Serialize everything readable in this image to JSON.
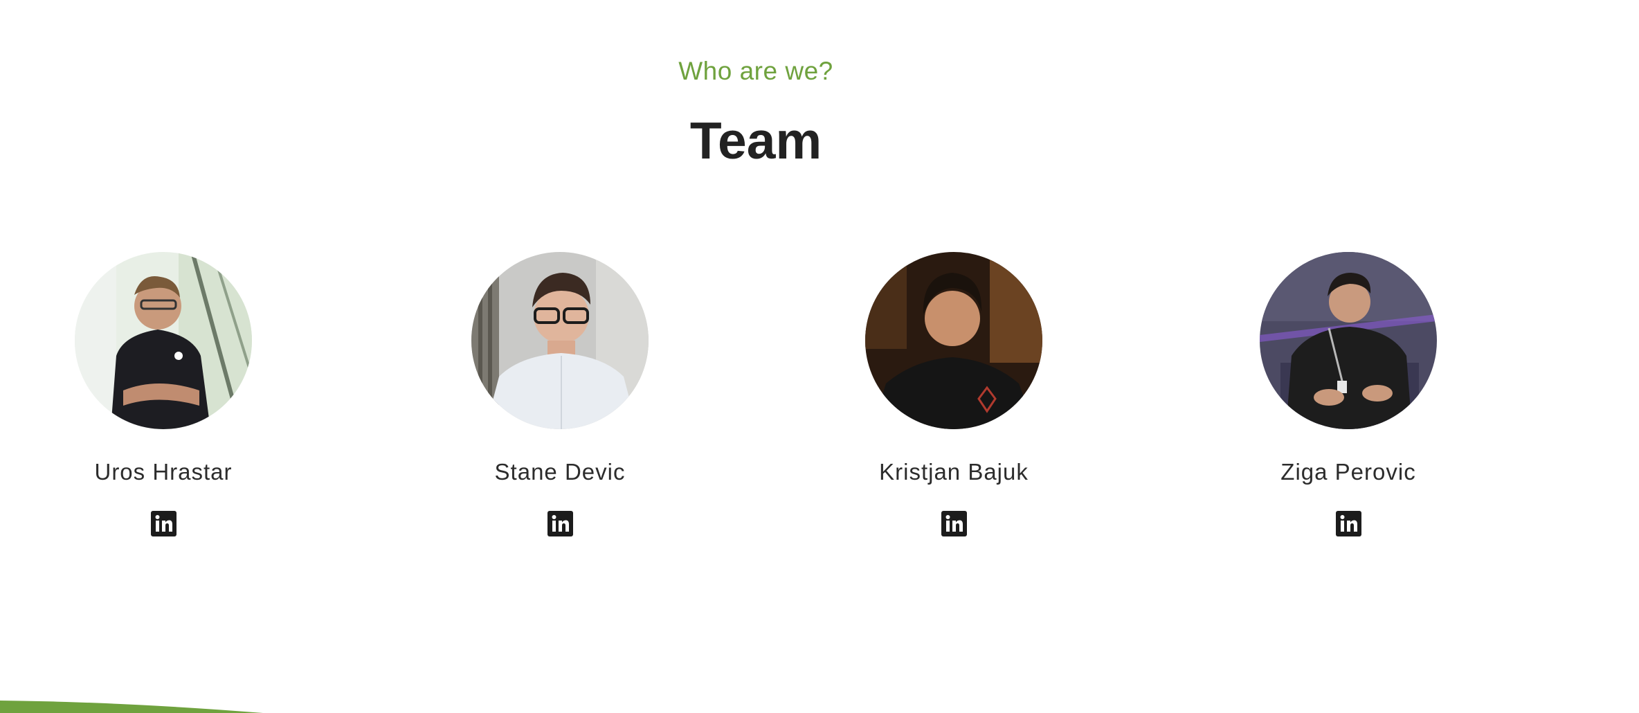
{
  "section": {
    "eyebrow": "Who are we?",
    "title": "Team"
  },
  "colors": {
    "accent": "#6fa23e",
    "text": "#222222",
    "icon": "#1c1c1c"
  },
  "team": [
    {
      "name": "Uros Hrastar",
      "link_icon": "linkedin-icon"
    },
    {
      "name": "Stane Devic",
      "link_icon": "linkedin-icon"
    },
    {
      "name": "Kristjan Bajuk",
      "link_icon": "linkedin-icon"
    },
    {
      "name": "Ziga Perovic",
      "link_icon": "linkedin-icon"
    }
  ]
}
